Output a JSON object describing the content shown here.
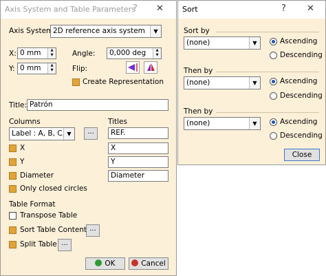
{
  "axis_dialog": {
    "title": "Axis System and Table Parameters",
    "help": "?",
    "close": "✕",
    "axis_system_label": "Axis System:",
    "axis_system_value": "2D reference axis system",
    "x_label": "X:",
    "x_value": "0 mm",
    "y_label": "Y:",
    "y_value": "0 mm",
    "angle_label": "Angle:",
    "angle_value": "0,000 deg",
    "flip_label": "Flip:",
    "create_representation_label": "Create Representation",
    "title_label": "Title:",
    "title_value": "Patrón",
    "columns_label": "Columns",
    "columns_select": "Label : A, B, C, ...",
    "dots": "...",
    "titles_label": "Titles",
    "titles_values": [
      "REF.",
      "X",
      "Y",
      "Diameter"
    ],
    "x_col_label": "X",
    "y_col_label": "Y",
    "diameter_label": "Diameter",
    "only_closed_label": "Only closed circles",
    "table_format_label": "Table Format",
    "transpose_label": "Transpose Table",
    "sort_content_label": "Sort Table Content",
    "split_label": "Split Table",
    "ok_label": "OK",
    "cancel_label": "Cancel"
  },
  "sort_dialog": {
    "title": "Sort",
    "help": "?",
    "close": "✕",
    "groups": [
      {
        "label": "Sort by",
        "value": "(none)",
        "asc": "Ascending",
        "desc": "Descending"
      },
      {
        "label": "Then by",
        "value": "(none)",
        "asc": "Ascending",
        "desc": "Descending"
      },
      {
        "label": "Then by",
        "value": "(none)",
        "asc": "Ascending",
        "desc": "Descending"
      }
    ],
    "close_label": "Close"
  },
  "colors": {
    "dialog_bg": "#fdf0d9",
    "checked": "#e1a33a",
    "radio": "#1e4fb5"
  }
}
